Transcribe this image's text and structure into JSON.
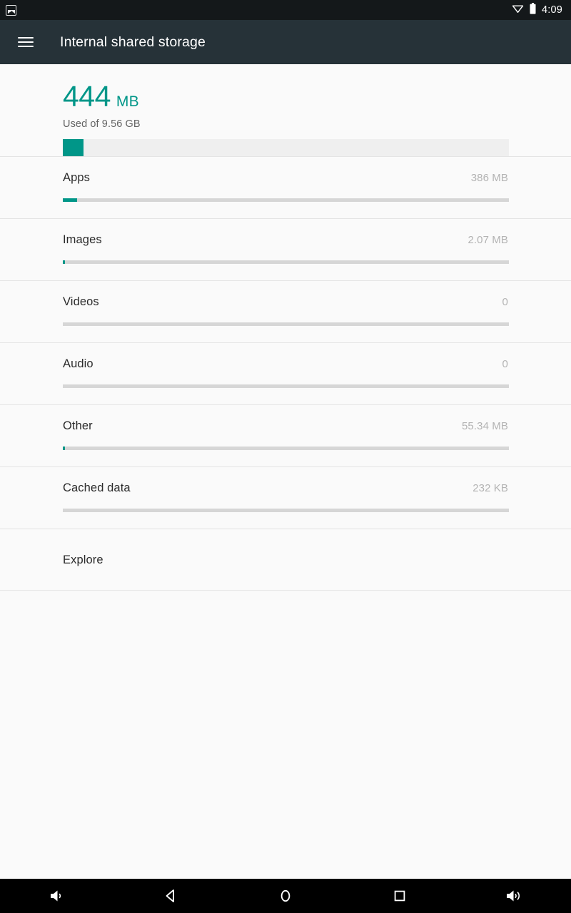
{
  "status_bar": {
    "notification_icon": "screenshot-image-icon",
    "wifi_icon": "wifi-no-signal-icon",
    "battery_icon": "battery-full-icon",
    "time": "4:09"
  },
  "app_bar": {
    "menu_icon": "hamburger-menu-icon",
    "title": "Internal shared storage"
  },
  "summary": {
    "value": "444",
    "unit": "MB",
    "subtitle": "Used of 9.56 GB",
    "used_percent": 4.6,
    "accent_color": "#009688",
    "track_color": "#efefef"
  },
  "storage_items": [
    {
      "label": "Apps",
      "value": "386 MB",
      "percent": 3.2,
      "has_bar": true
    },
    {
      "label": "Images",
      "value": "2.07 MB",
      "percent": 0.2,
      "has_bar": true
    },
    {
      "label": "Videos",
      "value": "0",
      "percent": 0,
      "has_bar": true
    },
    {
      "label": "Audio",
      "value": "0",
      "percent": 0,
      "has_bar": true
    },
    {
      "label": "Other",
      "value": "55.34 MB",
      "percent": 0.55,
      "has_bar": true
    },
    {
      "label": "Cached data",
      "value": "232 KB",
      "percent": 0,
      "has_bar": true
    },
    {
      "label": "Explore",
      "value": "",
      "percent": 0,
      "has_bar": false
    }
  ],
  "nav_bar": {
    "buttons": [
      {
        "name": "volume-down-icon",
        "label": "Volume down"
      },
      {
        "name": "back-icon",
        "label": "Back"
      },
      {
        "name": "home-icon",
        "label": "Home"
      },
      {
        "name": "recents-icon",
        "label": "Recent apps"
      },
      {
        "name": "volume-up-icon",
        "label": "Volume up"
      }
    ]
  }
}
